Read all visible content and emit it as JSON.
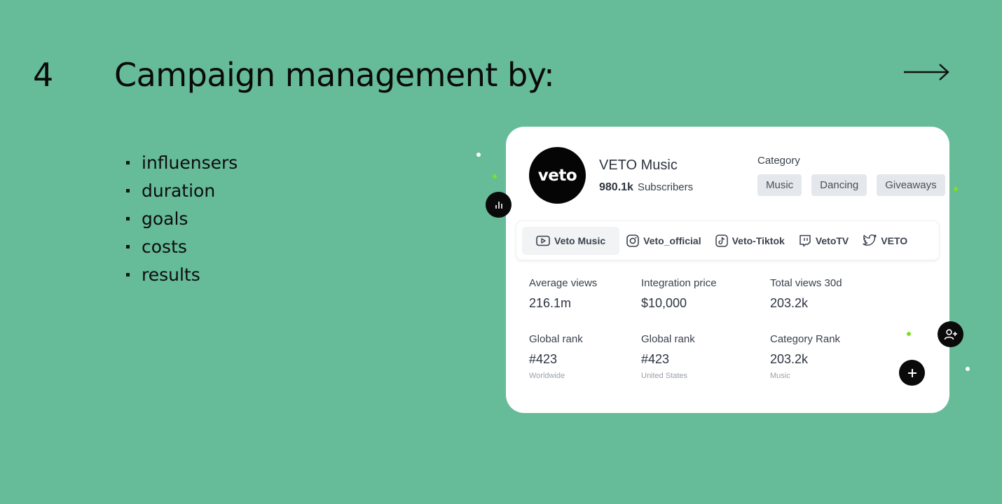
{
  "slide": {
    "number": "4",
    "title": "Campaign management by:",
    "bullets": [
      "influensers",
      "duration",
      "goals",
      "costs",
      "results"
    ]
  },
  "card": {
    "avatar_text": "veto",
    "channel_name": "VETO Music",
    "subscribers_count": "980.1k",
    "subscribers_label": "Subscribers",
    "category_label": "Category",
    "tags": [
      "Music",
      "Dancing",
      "Giveaways"
    ],
    "tabs": [
      {
        "label": "Veto Music",
        "icon": "youtube-icon"
      },
      {
        "label": "Veto_official",
        "icon": "instagram-icon"
      },
      {
        "label": "Veto-Tiktok",
        "icon": "tiktok-icon"
      },
      {
        "label": "VetoTV",
        "icon": "twitch-icon"
      },
      {
        "label": "VETO",
        "icon": "twitter-icon"
      }
    ],
    "stats": [
      {
        "label": "Average views",
        "value": "216.1m",
        "sub": ""
      },
      {
        "label": "Integration price",
        "value": "$10,000",
        "sub": ""
      },
      {
        "label": "Total views 30d",
        "value": "203.2k",
        "sub": ""
      },
      {
        "label": "Global rank",
        "value": "#423",
        "sub": "Worldwide"
      },
      {
        "label": "Global rank",
        "value": "#423",
        "sub": "United States"
      },
      {
        "label": "Category Rank",
        "value": "203.2k",
        "sub": "Music"
      }
    ]
  },
  "colors": {
    "background": "#66bb99",
    "card": "#ffffff",
    "accent_green": "#7ee01f",
    "dark": "#0a0a0a"
  }
}
